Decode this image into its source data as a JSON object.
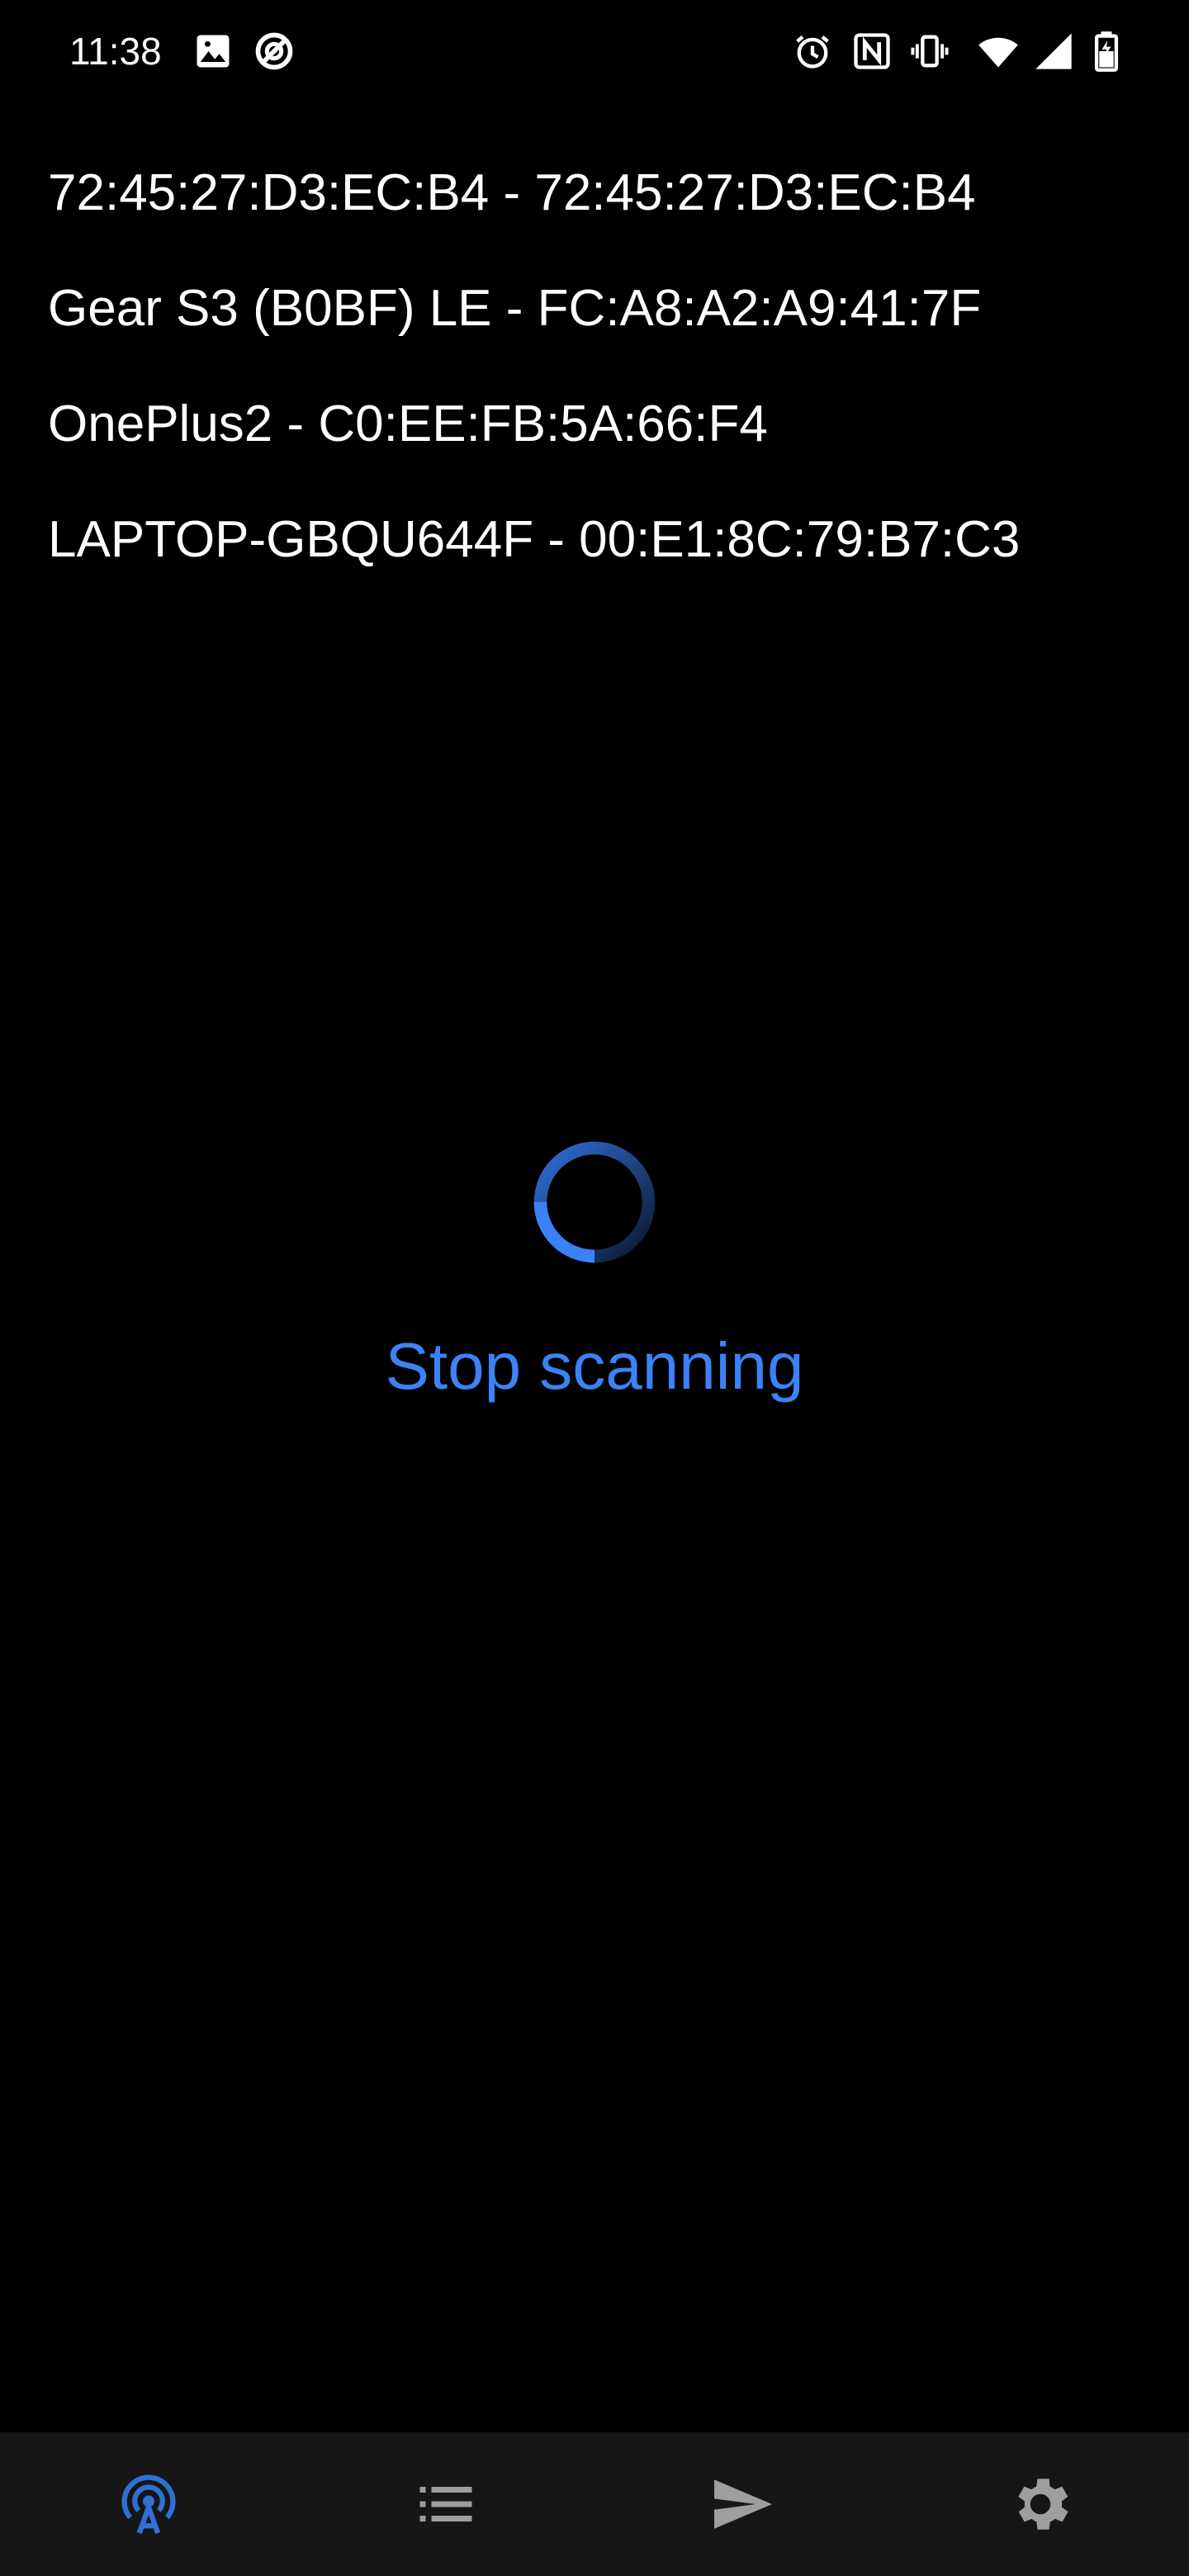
{
  "status_bar": {
    "time": "11:38",
    "left_icons": [
      "image-icon",
      "do-not-disturb-icon"
    ],
    "right_icons": [
      "alarm-icon",
      "nfc-icon",
      "vibrate-icon",
      "wifi-icon",
      "cell-signal-icon",
      "battery-icon"
    ]
  },
  "devices": [
    {
      "label": "72:45:27:D3:EC:B4 - 72:45:27:D3:EC:B4"
    },
    {
      "label": "Gear S3 (B0BF) LE - FC:A8:A2:A9:41:7F"
    },
    {
      "label": "OnePlus2 - C0:EE:FB:5A:66:F4"
    },
    {
      "label": "LAPTOP-GBQU644F - 00:E1:8C:79:B7:C3"
    }
  ],
  "scan": {
    "stop_label": "Stop scanning"
  },
  "bottom_nav": {
    "items": [
      {
        "icon": "scan-antenna-icon",
        "active": true
      },
      {
        "icon": "list-icon",
        "active": false
      },
      {
        "icon": "send-icon",
        "active": false
      },
      {
        "icon": "settings-gear-icon",
        "active": false
      }
    ]
  },
  "colors": {
    "accent": "#3b82f6",
    "background": "#000000",
    "nav_background": "#161616",
    "inactive_icon": "#9e9e9e",
    "text": "#ffffff"
  }
}
